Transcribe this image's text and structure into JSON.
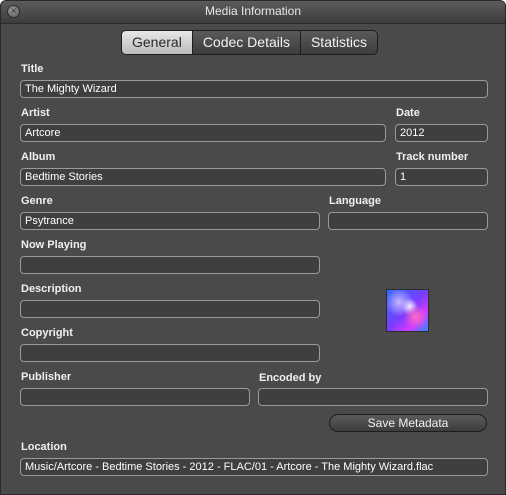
{
  "window": {
    "title": "Media Information",
    "close_glyph": "×"
  },
  "tabs": [
    {
      "label": "General",
      "active": true
    },
    {
      "label": "Codec Details",
      "active": false
    },
    {
      "label": "Statistics",
      "active": false
    }
  ],
  "fields": {
    "title": {
      "label": "Title",
      "value": "The Mighty Wizard"
    },
    "artist": {
      "label": "Artist",
      "value": "Artcore"
    },
    "date": {
      "label": "Date",
      "value": "2012"
    },
    "album": {
      "label": "Album",
      "value": "Bedtime Stories"
    },
    "track_number": {
      "label": "Track number",
      "value": "1"
    },
    "genre": {
      "label": "Genre",
      "value": "Psytrance"
    },
    "language": {
      "label": "Language",
      "value": ""
    },
    "now_playing": {
      "label": "Now Playing",
      "value": ""
    },
    "description": {
      "label": "Description",
      "value": ""
    },
    "copyright": {
      "label": "Copyright",
      "value": ""
    },
    "publisher": {
      "label": "Publisher",
      "value": ""
    },
    "encoded_by": {
      "label": "Encoded by",
      "value": ""
    },
    "location": {
      "label": "Location",
      "value": "Music/Artcore - Bedtime Stories - 2012 - FLAC/01 - Artcore - The Mighty Wizard.flac"
    }
  },
  "buttons": {
    "save_metadata": "Save Metadata"
  },
  "artwork": {
    "icon": "album-artwork"
  }
}
